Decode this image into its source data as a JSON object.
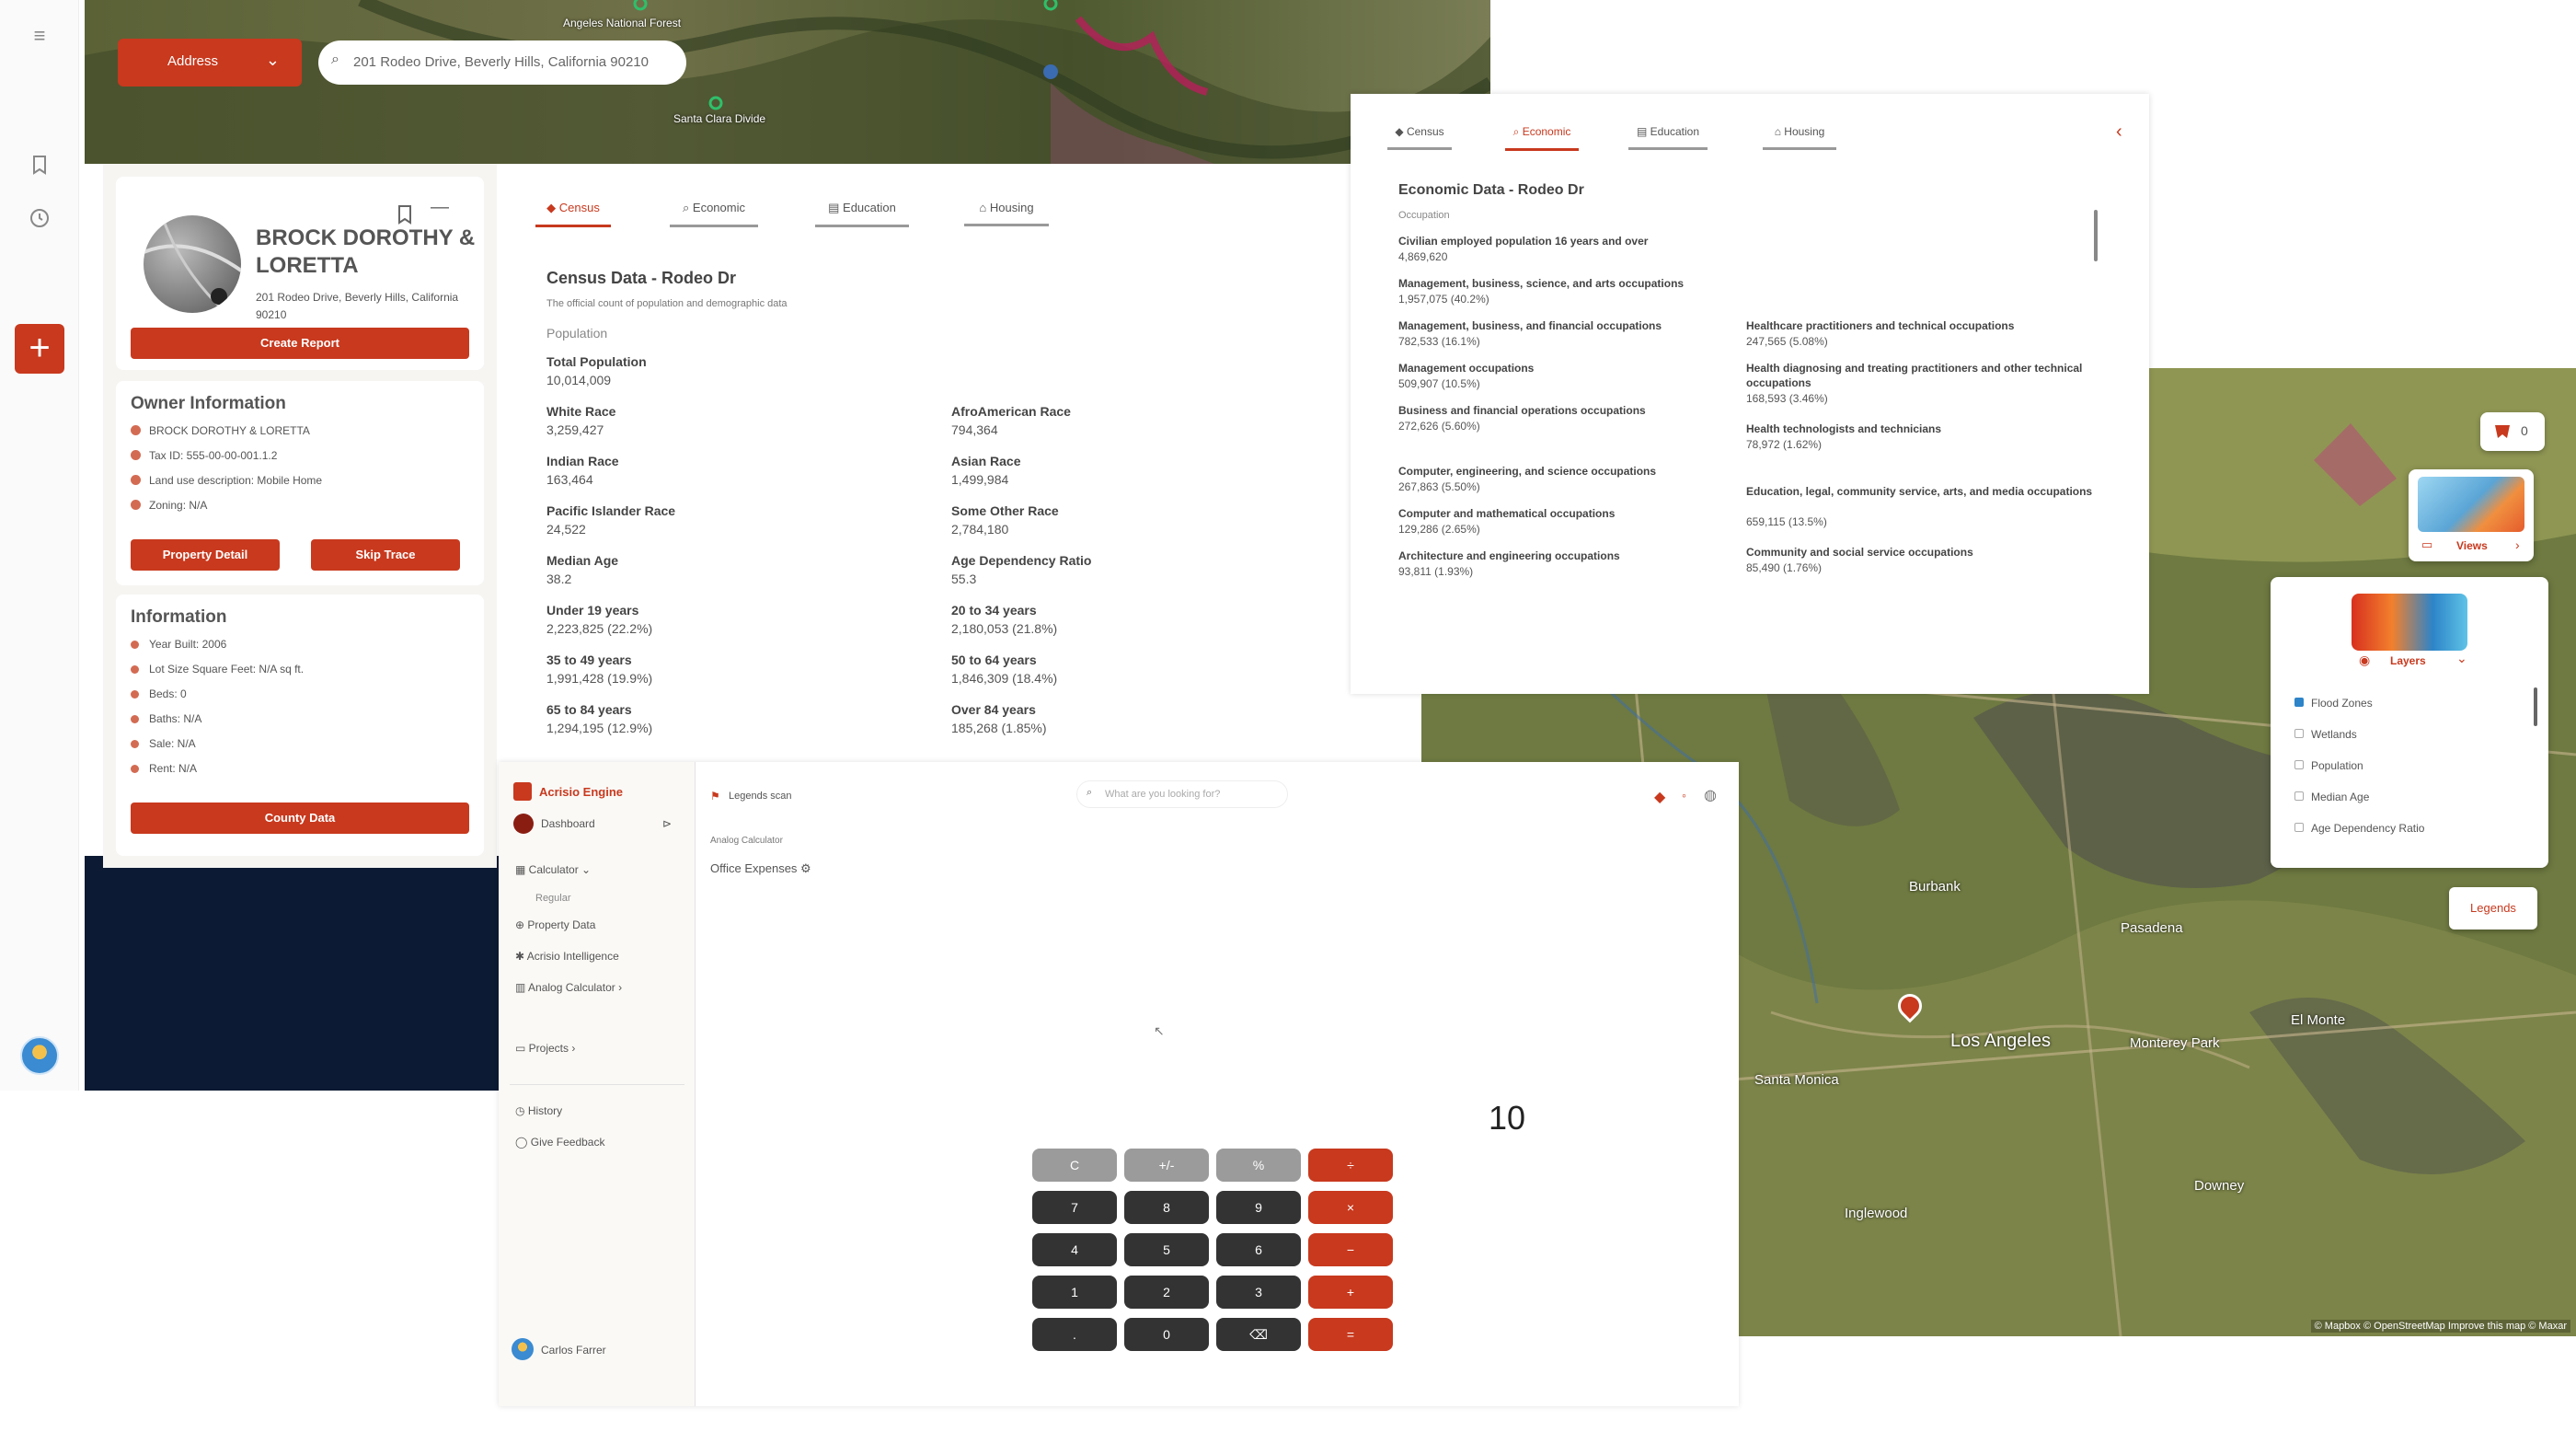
{
  "top_map": {
    "address_mode": "Address",
    "search_value": "201 Rodeo Drive, Beverly Hills, California 90210",
    "labels": [
      "Angeles National Forest",
      "Santa Clara Divide"
    ]
  },
  "property_card": {
    "owner_name": "BROCK DOROTHY & LORETTA",
    "address": "201 Rodeo Drive, Beverly Hills, California 90210",
    "create_report": "Create Report",
    "owner_section": "Owner Information",
    "owner_lines": [
      "BROCK DOROTHY & LORETTA",
      "Tax ID: 555-00-00-001.1.2",
      "Land use description: Mobile Home",
      "Zoning: N/A"
    ],
    "property_detail": "Property Detail",
    "skip_trace": "Skip Trace",
    "info_section": "Information",
    "info_lines": [
      "Year Built: 2006",
      "Lot Size Square Feet: N/A sq ft.",
      "Beds: 0",
      "Baths: N/A",
      "Sale: N/A",
      "Rent: N/A"
    ],
    "county_data": "County Data"
  },
  "census_panel": {
    "tabs": [
      "Census",
      "Economic",
      "Education",
      "Housing"
    ],
    "title": "Census Data - Rodeo Dr",
    "subtitle": "The official count of population and demographic data",
    "section": "Population",
    "stats": [
      {
        "label": "Total Population",
        "value": "10,014,009"
      },
      {
        "label": "White Race",
        "value": "3,259,427"
      },
      {
        "label": "AfroAmerican Race",
        "value": "794,364"
      },
      {
        "label": "Indian Race",
        "value": "163,464"
      },
      {
        "label": "Asian Race",
        "value": "1,499,984"
      },
      {
        "label": "Pacific Islander Race",
        "value": "24,522"
      },
      {
        "label": "Some Other Race",
        "value": "2,784,180"
      },
      {
        "label": "Median Age",
        "value": "38.2"
      },
      {
        "label": "Age Dependency Ratio",
        "value": "55.3"
      },
      {
        "label": "Under 19 years",
        "value": "2,223,825 (22.2%)"
      },
      {
        "label": "20 to 34 years",
        "value": "2,180,053 (21.8%)"
      },
      {
        "label": "35 to 49 years",
        "value": "1,991,428 (19.9%)"
      },
      {
        "label": "50 to 64 years",
        "value": "1,846,309 (18.4%)"
      },
      {
        "label": "65 to 84 years",
        "value": "1,294,195 (12.9%)"
      },
      {
        "label": "Over 84 years",
        "value": "185,268 (1.85%)"
      }
    ]
  },
  "economic_panel": {
    "tabs": [
      "Census",
      "Economic",
      "Education",
      "Housing"
    ],
    "title": "Economic Data - Rodeo Dr",
    "section": "Occupation",
    "left": [
      {
        "label": "Civilian employed population 16 years and over",
        "value": "4,869,620"
      },
      {
        "label": "Management, business, science, and arts occupations",
        "value": "1,957,075 (40.2%)"
      },
      {
        "label": "Management, business, and financial occupations",
        "value": "782,533 (16.1%)"
      },
      {
        "label": "Management occupations",
        "value": "509,907 (10.5%)"
      },
      {
        "label": "Business and financial operations occupations",
        "value": "272,626 (5.60%)"
      },
      {
        "label": "Computer, engineering, and science occupations",
        "value": "267,863 (5.50%)"
      },
      {
        "label": "Computer and mathematical occupations",
        "value": "129,286 (2.65%)"
      },
      {
        "label": "Architecture and engineering occupations",
        "value": "93,811 (1.93%)"
      }
    ],
    "right": [
      {
        "label": "Healthcare practitioners and technical occupations",
        "value": "247,565 (5.08%)"
      },
      {
        "label": "Health diagnosing and treating practitioners and other technical occupations",
        "value": "168,593 (3.46%)"
      },
      {
        "label": "Health technologists and technicians",
        "value": "78,972 (1.62%)"
      },
      {
        "label": "Education, legal, community service, arts, and media occupations",
        "value": "659,115 (13.5%)"
      },
      {
        "label": "Community and social service occupations",
        "value": "85,490 (1.76%)"
      }
    ]
  },
  "calculator_app": {
    "brand": "Acrisio Engine",
    "dashboard": "Dashboard",
    "calculator": "Calculator",
    "regular": "Regular",
    "property_data": "Property Data",
    "acrisio_intelligence": "Acrisio Intelligence",
    "analog_calculator": "Analog Calculator",
    "projects": "Projects",
    "history": "History",
    "give_feedback": "Give Feedback",
    "user": "Carlos Farrer",
    "breadcrumb": "Legends scan",
    "search_placeholder": "What are you looking for?",
    "crumb": "Analog Calculator",
    "page_title": "Office Expenses",
    "display": "10",
    "keys": [
      "C",
      "+/-",
      "%",
      "÷",
      "7",
      "8",
      "9",
      "×",
      "4",
      "5",
      "6",
      "−",
      "1",
      "2",
      "3",
      "+",
      ".",
      "0",
      "⌫",
      "="
    ]
  },
  "right_map": {
    "views": "Views",
    "layers": "Layers",
    "layer_items": [
      "Flood Zones",
      "Wetlands",
      "Population",
      "Median Age",
      "Age Dependency Ratio"
    ],
    "legends": "Legends",
    "filter_count": "0",
    "place_labels": [
      "Los Angeles",
      "Santa Monica",
      "Pasadena",
      "Burbank",
      "Monterey Park",
      "Inglewood",
      "Downey",
      "El Monte"
    ],
    "attribution": "© Mapbox © OpenStreetMap Improve this map © Maxar"
  },
  "colors": {
    "accent": "#c8391e"
  }
}
